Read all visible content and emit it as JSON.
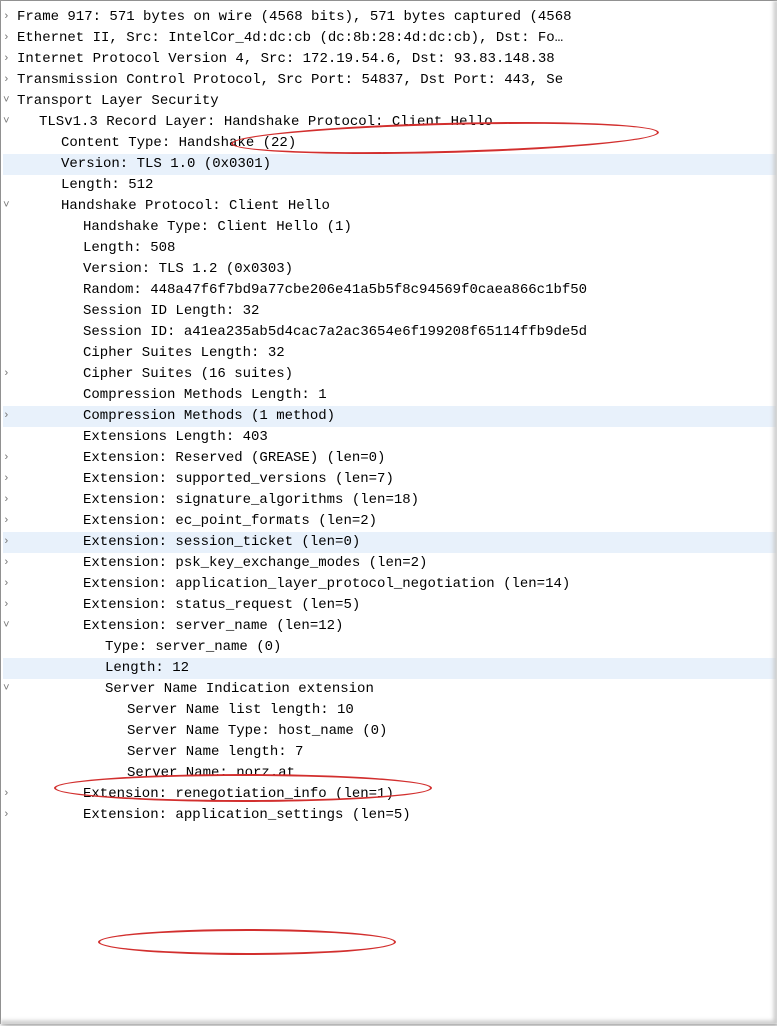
{
  "rows": [
    {
      "indent": 0,
      "caret": "closed",
      "hl": false,
      "text": "Frame 917: 571 bytes on wire (4568 bits), 571 bytes captured (4568"
    },
    {
      "indent": 0,
      "caret": "closed",
      "hl": false,
      "text": "Ethernet II, Src: IntelCor_4d:dc:cb (dc:8b:28:4d:dc:cb), Dst: Fo…"
    },
    {
      "indent": 0,
      "caret": "closed",
      "hl": false,
      "text": "Internet Protocol Version 4, Src: 172.19.54.6, Dst: 93.83.148.38"
    },
    {
      "indent": 0,
      "caret": "closed",
      "hl": false,
      "text": "Transmission Control Protocol, Src Port: 54837, Dst Port: 443, Se"
    },
    {
      "indent": 0,
      "caret": "open",
      "hl": false,
      "text": "Transport Layer Security"
    },
    {
      "indent": 1,
      "caret": "open",
      "hl": false,
      "text": "TLSv1.3 Record Layer: Handshake Protocol: Client Hello"
    },
    {
      "indent": 2,
      "caret": "none",
      "hl": false,
      "text": "Content Type: Handshake (22)"
    },
    {
      "indent": 2,
      "caret": "none",
      "hl": true,
      "text": "Version: TLS 1.0 (0x0301)"
    },
    {
      "indent": 2,
      "caret": "none",
      "hl": false,
      "text": "Length: 512"
    },
    {
      "indent": 2,
      "caret": "open",
      "hl": false,
      "text": "Handshake Protocol: Client Hello"
    },
    {
      "indent": 3,
      "caret": "none",
      "hl": false,
      "text": "Handshake Type: Client Hello (1)"
    },
    {
      "indent": 3,
      "caret": "none",
      "hl": false,
      "text": "Length: 508"
    },
    {
      "indent": 3,
      "caret": "none",
      "hl": false,
      "text": "Version: TLS 1.2 (0x0303)"
    },
    {
      "indent": 3,
      "caret": "none",
      "hl": false,
      "text": "Random: 448a47f6f7bd9a77cbe206e41a5b5f8c94569f0caea866c1bf50"
    },
    {
      "indent": 3,
      "caret": "none",
      "hl": false,
      "text": "Session ID Length: 32"
    },
    {
      "indent": 3,
      "caret": "none",
      "hl": false,
      "text": "Session ID: a41ea235ab5d4cac7a2ac3654e6f199208f65114ffb9de5d"
    },
    {
      "indent": 3,
      "caret": "none",
      "hl": false,
      "text": "Cipher Suites Length: 32"
    },
    {
      "indent": 3,
      "caret": "closed",
      "hl": false,
      "text": "Cipher Suites (16 suites)"
    },
    {
      "indent": 3,
      "caret": "none",
      "hl": false,
      "text": "Compression Methods Length: 1"
    },
    {
      "indent": 3,
      "caret": "closed",
      "hl": true,
      "text": "Compression Methods (1 method)"
    },
    {
      "indent": 3,
      "caret": "none",
      "hl": false,
      "text": "Extensions Length: 403"
    },
    {
      "indent": 3,
      "caret": "closed",
      "hl": false,
      "text": "Extension: Reserved (GREASE) (len=0)"
    },
    {
      "indent": 3,
      "caret": "closed",
      "hl": false,
      "text": "Extension: supported_versions (len=7)"
    },
    {
      "indent": 3,
      "caret": "closed",
      "hl": false,
      "text": "Extension: signature_algorithms (len=18)"
    },
    {
      "indent": 3,
      "caret": "closed",
      "hl": false,
      "text": "Extension: ec_point_formats (len=2)"
    },
    {
      "indent": 3,
      "caret": "closed",
      "hl": true,
      "text": "Extension: session_ticket (len=0)"
    },
    {
      "indent": 3,
      "caret": "closed",
      "hl": false,
      "text": "Extension: psk_key_exchange_modes (len=2)"
    },
    {
      "indent": 3,
      "caret": "closed",
      "hl": false,
      "text": "Extension: application_layer_protocol_negotiation (len=14)"
    },
    {
      "indent": 3,
      "caret": "closed",
      "hl": false,
      "text": "Extension: status_request (len=5)"
    },
    {
      "indent": 3,
      "caret": "open",
      "hl": false,
      "text": "Extension: server_name (len=12)"
    },
    {
      "indent": 4,
      "caret": "none",
      "hl": false,
      "text": "Type: server_name (0)"
    },
    {
      "indent": 4,
      "caret": "none",
      "hl": true,
      "text": "Length: 12"
    },
    {
      "indent": 4,
      "caret": "open",
      "hl": false,
      "text": "Server Name Indication extension"
    },
    {
      "indent": 5,
      "caret": "none",
      "hl": false,
      "text": "Server Name list length: 10"
    },
    {
      "indent": 5,
      "caret": "none",
      "hl": false,
      "text": "Server Name Type: host_name (0)"
    },
    {
      "indent": 5,
      "caret": "none",
      "hl": false,
      "text": "Server Name length: 7"
    },
    {
      "indent": 5,
      "caret": "none",
      "hl": false,
      "text": "Server Name: norz.at"
    },
    {
      "indent": 3,
      "caret": "closed",
      "hl": false,
      "text": "Extension: renegotiation_info (len=1)"
    },
    {
      "indent": 3,
      "caret": "closed",
      "hl": false,
      "text": "Extension: application_settings (len=5)"
    }
  ]
}
